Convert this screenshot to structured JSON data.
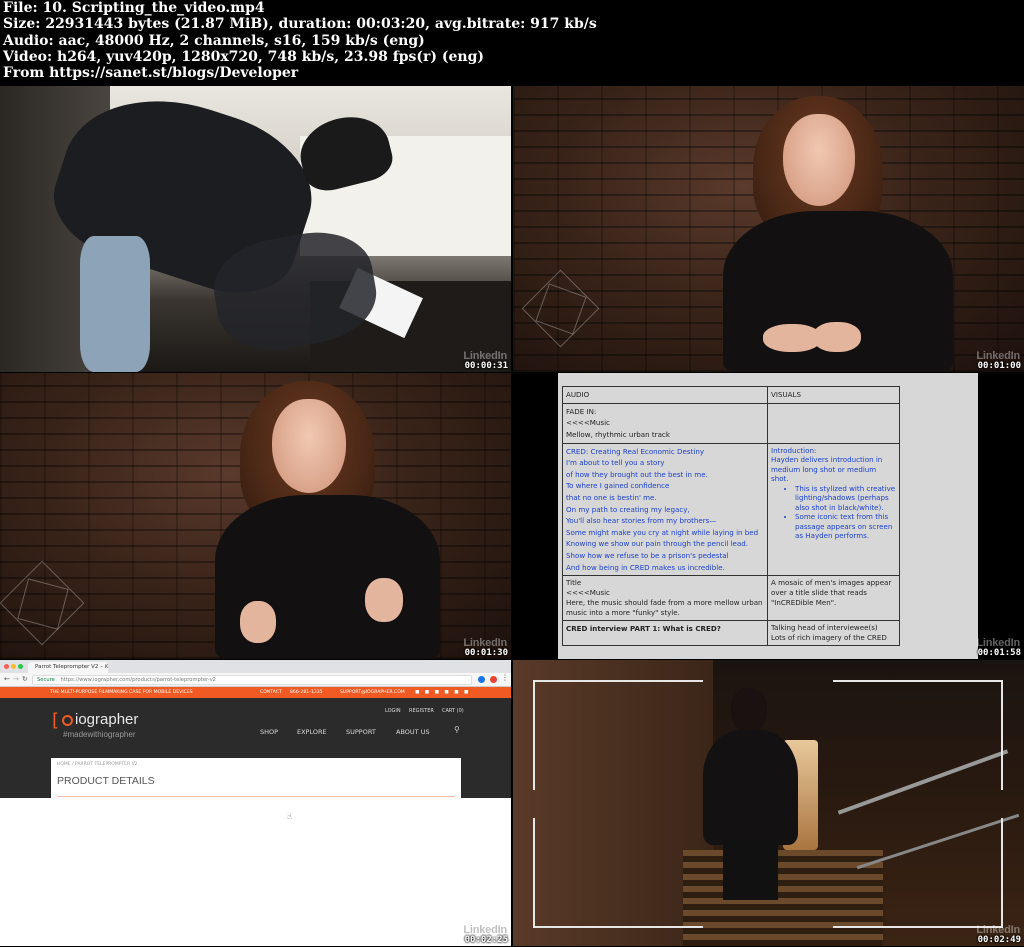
{
  "header": {
    "lines": [
      "File: 10. Scripting_the_video.mp4",
      "Size: 22931443 bytes (21.87 MiB), duration: 00:03:20, avg.bitrate: 917 kb/s",
      "Audio: aac, 48000 Hz, 2 channels, s16, 159 kb/s (eng)",
      "Video: h264, yuv420p, 1280x720, 748 kb/s, 23.98 fps(r) (eng)",
      "From https://sanet.st/blogs/Developer"
    ]
  },
  "watermark": "LinkedIn",
  "thumbnails": [
    {
      "timestamp": "00:00:31",
      "scene": "signing-paper"
    },
    {
      "timestamp": "00:01:00",
      "scene": "presenter"
    },
    {
      "timestamp": "00:01:30",
      "scene": "presenter"
    },
    {
      "timestamp": "00:01:58",
      "scene": "script-document"
    },
    {
      "timestamp": "00:02:25",
      "scene": "browser"
    },
    {
      "timestamp": "00:02:49",
      "scene": "stairs"
    }
  ],
  "script": {
    "header_audio": "AUDIO",
    "header_visuals": "VISUALS",
    "row1_audio": [
      "FADE IN:",
      "<<<<Music",
      "Mellow, rhythmic urban track"
    ],
    "row2_audio": [
      "CRED: Creating Real Economic Destiny",
      "I'm about to tell you a story",
      "of how they brought out the best in me.",
      "To where I gained confidence",
      "that no one is bestin' me.",
      "On my path to creating my legacy,",
      "You'll also hear stories from my brothers—",
      "Some might make you cry at night while laying in bed",
      "Knowing we show our pain through the pencil lead.",
      "Show how we refuse to be a prison's pedestal",
      "And how being in CRED makes us incredible."
    ],
    "row2_visuals_intro": [
      "Introduction:",
      "Hayden delivers introduction in medium long shot or medium shot."
    ],
    "row2_visuals_bullets": [
      "This is stylized with creative lighting/shadows (perhaps also shot in black/white).",
      "Some iconic text from this passage appears on screen as Hayden performs."
    ],
    "row3_audio": [
      "Title",
      "<<<<Music",
      "Here, the music should fade from a more mellow urban music into a more \"funky\" style."
    ],
    "row3_visuals": "A mosaic of men's images appear over a title slide that reads \"InCREDible Men\".",
    "row4_audio": "CRED interview PART 1: What is CRED?",
    "row4_visuals": [
      "Talking head of interviewee(s)",
      "Lots of rich imagery of the CRED"
    ]
  },
  "browser": {
    "tab_title": "Parrot Teleprompter V2 – iOgr",
    "secure": "Secure",
    "url": "https://www.iographer.com/products/parrot-teleprompter-v2",
    "promo": "THE MULTI-PURPOSE FILMMAKING CASE FOR MOBILE DEVICES",
    "contact": "CONTACT",
    "phone": "866-281-1335",
    "email": "SUPPORT@IOGRAPHER.COM",
    "logo": "iographer",
    "tagline": "#madewithiographer",
    "login": "LOGIN",
    "register": "REGISTER",
    "cart": "CART (0)",
    "nav": [
      "SHOP",
      "EXPLORE",
      "SUPPORT",
      "ABOUT US"
    ],
    "breadcrumb": "HOME  /  PARROT TELEPROMPTER V2",
    "product_title": "PRODUCT DETAILS"
  }
}
